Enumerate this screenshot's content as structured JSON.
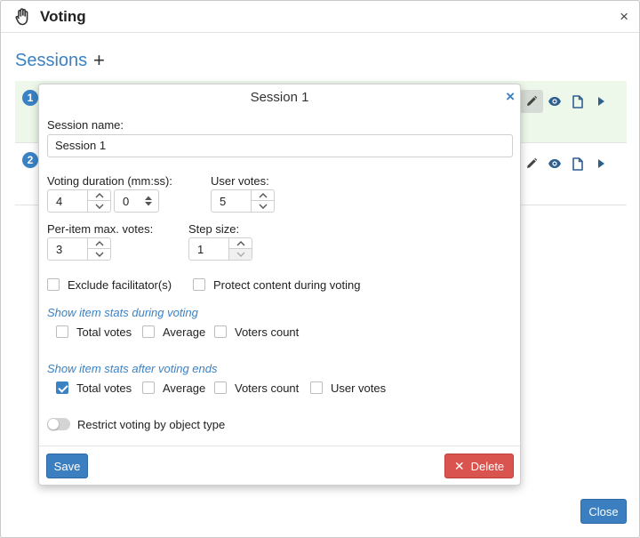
{
  "window": {
    "title": "Voting",
    "close_glyph": "×"
  },
  "sessions": {
    "title": "Sessions",
    "add_glyph": "+",
    "rows": [
      {
        "number": "1"
      },
      {
        "number": "2"
      }
    ],
    "action_icons": [
      "pencil-icon",
      "eye-icon",
      "document-icon",
      "play-icon"
    ]
  },
  "modal": {
    "title": "Session 1",
    "close_glyph": "×",
    "session_name_label": "Session name:",
    "session_name_value": "Session 1",
    "duration_label": "Voting duration (mm:ss):",
    "duration_minutes": "4",
    "duration_seconds": "0",
    "user_votes_label": "User votes:",
    "user_votes_value": "5",
    "per_item_label": "Per-item max. votes:",
    "per_item_value": "3",
    "step_size_label": "Step size:",
    "step_size_value": "1",
    "exclude_facilitator_label": "Exclude facilitator(s)",
    "exclude_facilitator_checked": false,
    "protect_content_label": "Protect content during voting",
    "protect_content_checked": false,
    "during_title": "Show item stats during voting",
    "during_options": [
      {
        "label": "Total votes",
        "checked": false
      },
      {
        "label": "Average",
        "checked": false
      },
      {
        "label": "Voters count",
        "checked": false
      }
    ],
    "after_title": "Show item stats after voting ends",
    "after_options": [
      {
        "label": "Total votes",
        "checked": true
      },
      {
        "label": "Average",
        "checked": false
      },
      {
        "label": "Voters count",
        "checked": false
      },
      {
        "label": "User votes",
        "checked": false
      }
    ],
    "restrict_label": "Restrict voting by object type",
    "restrict_on": false,
    "save_label": "Save",
    "delete_label": "Delete",
    "delete_glyph": "✕"
  },
  "footer": {
    "close_label": "Close"
  },
  "colors": {
    "accent": "#3b82c4",
    "selected_row": "#eef8ea",
    "delete": "#d9534f"
  }
}
